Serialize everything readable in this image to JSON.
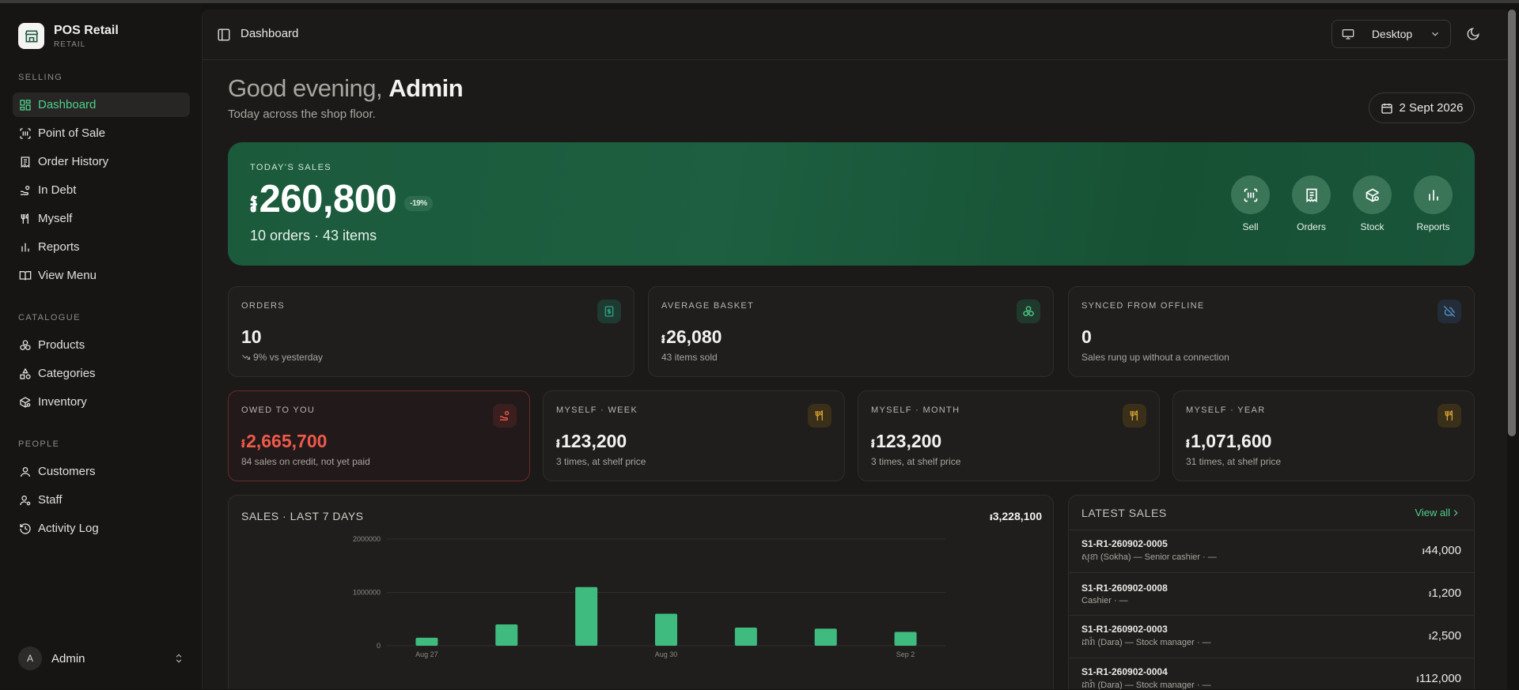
{
  "app": {
    "name": "POS Retail",
    "subtitle": "RETAIL"
  },
  "sidebar": {
    "sections": [
      {
        "label": "SELLING",
        "items": [
          {
            "label": "Dashboard",
            "icon": "grid-icon",
            "active": true
          },
          {
            "label": "Point of Sale",
            "icon": "scan-icon"
          },
          {
            "label": "Order History",
            "icon": "receipt-icon"
          },
          {
            "label": "In Debt",
            "icon": "hand-coins-icon"
          },
          {
            "label": "Myself",
            "icon": "utensils-icon"
          },
          {
            "label": "Reports",
            "icon": "bar-chart-icon"
          },
          {
            "label": "View Menu",
            "icon": "book-open-icon"
          }
        ]
      },
      {
        "label": "CATALOGUE",
        "items": [
          {
            "label": "Products",
            "icon": "boxes-icon"
          },
          {
            "label": "Categories",
            "icon": "shapes-icon"
          },
          {
            "label": "Inventory",
            "icon": "package-search-icon"
          }
        ]
      },
      {
        "label": "PEOPLE",
        "items": [
          {
            "label": "Customers",
            "icon": "user-icon"
          },
          {
            "label": "Staff",
            "icon": "user-cog-icon"
          },
          {
            "label": "Activity Log",
            "icon": "history-icon"
          }
        ]
      }
    ],
    "user": {
      "initial": "A",
      "name": "Admin"
    }
  },
  "topbar": {
    "breadcrumb": "Dashboard",
    "device": "Desktop"
  },
  "greeting": {
    "prefix": "Good evening,",
    "name": "Admin",
    "subtitle": "Today across the shop floor.",
    "date": "2 Sept 2026"
  },
  "currency_symbol": "៛",
  "hero": {
    "label": "TODAY'S SALES",
    "amount": "260,800",
    "change": "-19%",
    "summary": "10 orders · 43 items",
    "actions": [
      {
        "label": "Sell",
        "icon": "scan-barcode-icon"
      },
      {
        "label": "Orders",
        "icon": "receipt-icon"
      },
      {
        "label": "Stock",
        "icon": "package-search-icon"
      },
      {
        "label": "Reports",
        "icon": "bar-chart-icon"
      }
    ]
  },
  "stats": [
    {
      "label": "ORDERS",
      "value": "10",
      "currency": false,
      "sub": "9% vs yesterday",
      "icon": "receipt-icon",
      "accent": "#2ba37a"
    },
    {
      "label": "AVERAGE BASKET",
      "value": "26,080",
      "currency": true,
      "sub": "43 items sold",
      "icon": "boxes-icon",
      "accent": "#4fd08e"
    },
    {
      "label": "SYNCED FROM OFFLINE",
      "value": "0",
      "currency": false,
      "sub": "Sales rung up without a connection",
      "icon": "cloud-off-icon",
      "accent": "#5b93c7"
    }
  ],
  "stats2": [
    {
      "label": "OWED TO YOU",
      "value": "2,665,700",
      "sub": "84 sales on credit, not yet paid",
      "icon": "hand-coins-icon",
      "accent": "#ef5a4a"
    },
    {
      "label": "MYSELF · WEEK",
      "value": "123,200",
      "sub": "3 times, at shelf price",
      "icon": "utensils-icon",
      "accent": "#d4a032"
    },
    {
      "label": "MYSELF · MONTH",
      "value": "123,200",
      "sub": "3 times, at shelf price",
      "icon": "utensils-icon",
      "accent": "#d4a032"
    },
    {
      "label": "MYSELF · YEAR",
      "value": "1,071,600",
      "sub": "31 times, at shelf price",
      "icon": "utensils-icon",
      "accent": "#d4a032"
    }
  ],
  "chart_title": "SALES · LAST 7 DAYS",
  "chart_total": "3,228,100",
  "chart_data": {
    "type": "bar",
    "categories": [
      "Aug 27",
      "Aug 28",
      "Aug 29",
      "Aug 30",
      "Aug 31",
      "Sep 1",
      "Sep 2"
    ],
    "x_tick_labels": [
      "Aug 27",
      "Aug 30",
      "Sep 2"
    ],
    "values": [
      150000,
      400000,
      1100000,
      600000,
      340000,
      320000,
      260000
    ],
    "y_ticks": [
      "0",
      "1000000",
      "2000000"
    ],
    "ylim": [
      0,
      2000000
    ],
    "grid": true,
    "color": "#3fbb7f"
  },
  "latest_sales": {
    "title": "LATEST SALES",
    "view_all": "View all",
    "rows": [
      {
        "id": "S1-R1-260902-0005",
        "meta": "សុខា (Sokha) — Senior cashier · —",
        "amount": "44,000"
      },
      {
        "id": "S1-R1-260902-0008",
        "meta": "Cashier · —",
        "amount": "1,200"
      },
      {
        "id": "S1-R1-260902-0003",
        "meta": "ដារ៉ា (Dara) — Stock manager · —",
        "amount": "2,500"
      },
      {
        "id": "S1-R1-260902-0004",
        "meta": "ដារ៉ា (Dara) — Stock manager · —",
        "amount": "112,000"
      }
    ]
  }
}
